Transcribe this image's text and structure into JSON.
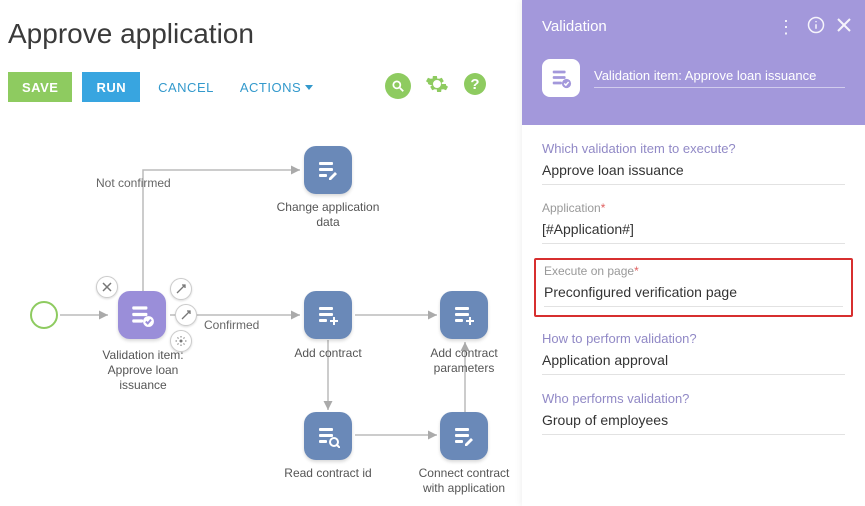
{
  "page": {
    "title": "Approve application"
  },
  "toolbar": {
    "save": "SAVE",
    "run": "RUN",
    "cancel": "CANCEL",
    "actions": "ACTIONS"
  },
  "flow": {
    "nodes": {
      "validation": "Validation item: Approve loan issuance",
      "change_app": "Change application data",
      "add_contract": "Add contract",
      "add_params": "Add contract parameters",
      "read_contract": "Read contract id",
      "connect_contract": "Connect contract with application"
    },
    "edges": {
      "not_confirmed": "Not confirmed",
      "confirmed": "Confirmed"
    }
  },
  "panel": {
    "title": "Validation",
    "subtitle": "Validation item: Approve loan issuance",
    "fields": {
      "which_item": {
        "label": "Which validation item to execute?",
        "value": "Approve loan issuance"
      },
      "application": {
        "label": "Application",
        "value": "[#Application#]"
      },
      "execute_page": {
        "label": "Execute on page",
        "value": "Preconfigured verification page"
      },
      "how_perform": {
        "label": "How to perform validation?",
        "value": "Application approval"
      },
      "who_performs": {
        "label": "Who performs validation?",
        "value": "Group of employees"
      }
    }
  }
}
